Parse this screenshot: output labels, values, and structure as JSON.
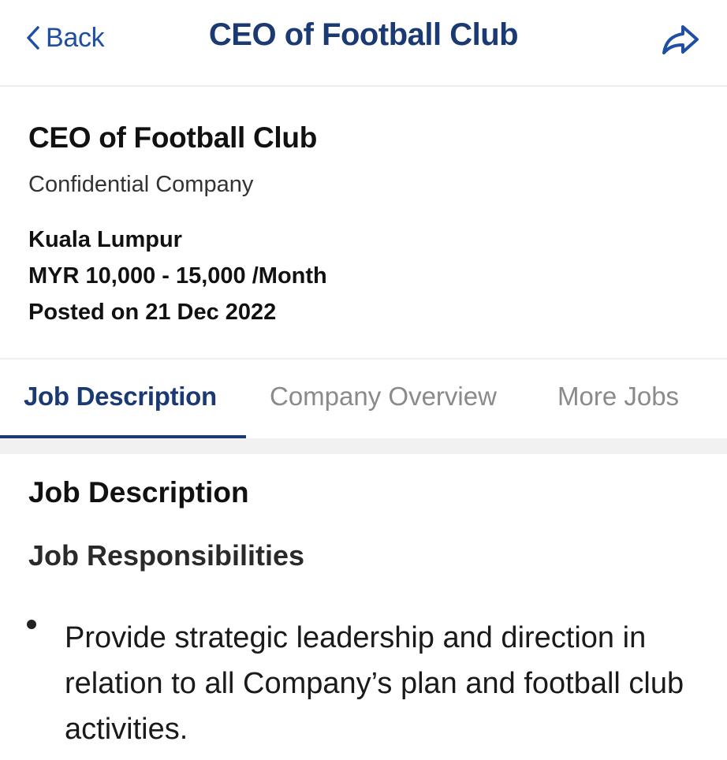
{
  "nav": {
    "back_label": "Back",
    "title": "CEO of Football Club",
    "back_icon": "chevron-left-icon",
    "share_icon": "share-icon",
    "accent": "#1f4fa3",
    "title_color": "#1b3a73"
  },
  "job": {
    "title": "CEO of Football Club",
    "company": "Confidential Company",
    "location": "Kuala Lumpur",
    "salary": "MYR 10,000 - 15,000 /Month",
    "posted": "Posted on 21 Dec 2022"
  },
  "tabs": [
    {
      "label": "Job Description",
      "active": true
    },
    {
      "label": "Company Overview",
      "active": false
    },
    {
      "label": "More Jobs",
      "active": false
    }
  ],
  "content": {
    "heading": "Job Description",
    "subheading": "Job Responsibilities",
    "bullets": [
      "Provide strategic leadership and direction in relation to all Company’s plan and football club activities."
    ]
  }
}
